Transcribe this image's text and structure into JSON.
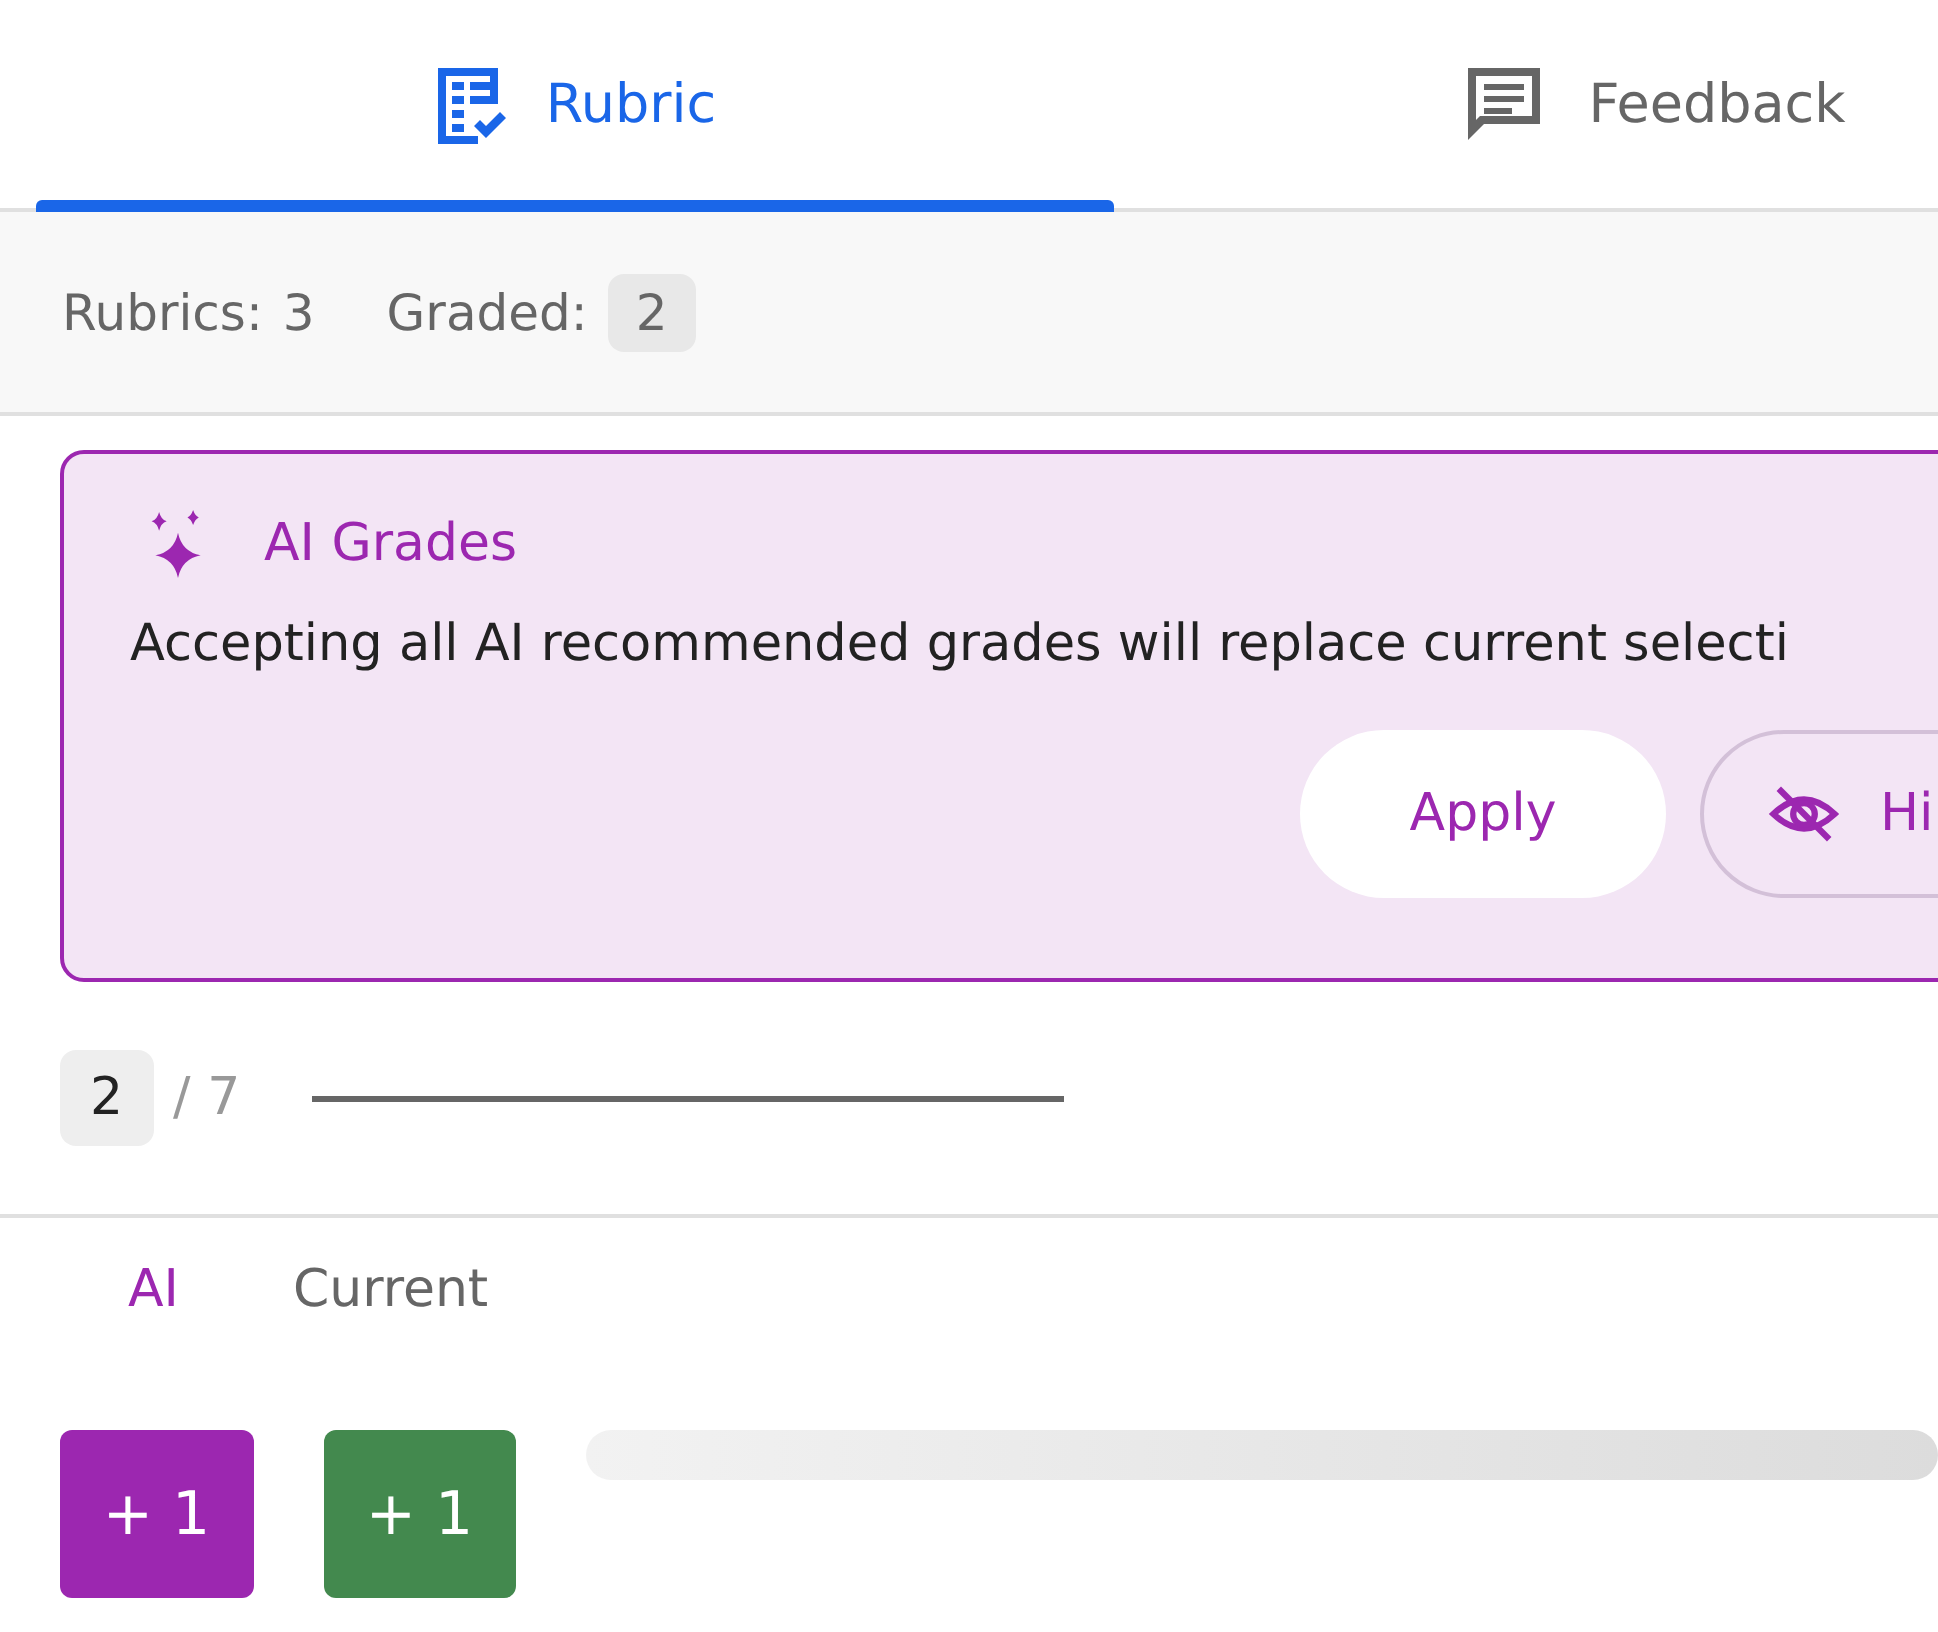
{
  "tabs": [
    {
      "label": "Rubric",
      "kind": "rubric",
      "selected": true
    },
    {
      "label": "Feedback",
      "kind": "feedback",
      "selected": false
    }
  ],
  "summary": {
    "rubrics_label": "Rubrics:",
    "rubrics_count": "3",
    "graded_label": "Graded:",
    "graded_count": "2"
  },
  "ai_card": {
    "title": "AI Grades",
    "message": "Accepting all AI recommended grades will replace current selecti",
    "buttons": [
      {
        "label": "Apply",
        "kind": "filled"
      },
      {
        "label": "Hi",
        "kind": "outlined"
      }
    ]
  },
  "pager": {
    "current": "2",
    "total": "/ 7"
  },
  "columns": [
    {
      "label": "AI",
      "kind": "ai"
    },
    {
      "label": "Current",
      "kind": "current"
    }
  ],
  "scores": [
    {
      "value": "+ 1",
      "kind": "ai"
    },
    {
      "value": "+ 1",
      "kind": "current"
    }
  ]
}
